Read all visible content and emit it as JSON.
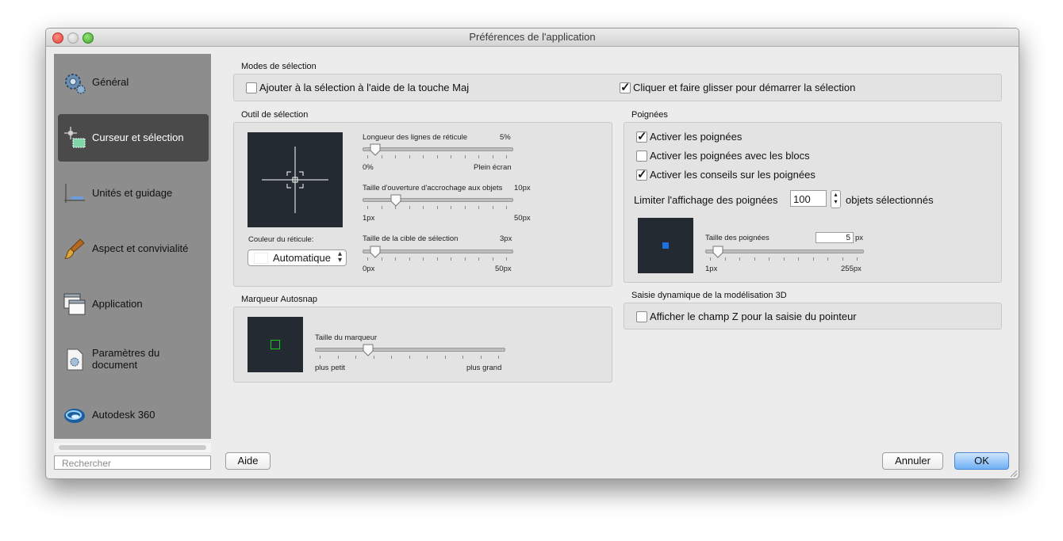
{
  "window": {
    "title": "Préférences de l'application"
  },
  "sidebar": {
    "items": [
      {
        "label": "Général",
        "icon": "gear-icon",
        "active": false
      },
      {
        "label": "Curseur et sélection",
        "icon": "crosshair-selection-icon",
        "active": true
      },
      {
        "label": "Unités et guidage",
        "icon": "ruler-icon",
        "active": false
      },
      {
        "label": "Aspect et convivialité",
        "icon": "paintbrush-icon",
        "active": false
      },
      {
        "label": "Application",
        "icon": "windows-icon",
        "active": false
      },
      {
        "label_line1": "Paramètres du",
        "label_line2": "document",
        "icon": "document-gear-icon",
        "active": false
      },
      {
        "label": "Autodesk 360",
        "icon": "autodesk-360-icon",
        "active": false
      }
    ],
    "search_placeholder": "Rechercher"
  },
  "selection_modes": {
    "title": "Modes de sélection",
    "shift_add": {
      "label": "Ajouter à la sélection à l'aide de la touche Maj",
      "checked": false
    },
    "click_drag": {
      "label": "Cliquer et faire glisser pour démarrer la sélection",
      "checked": true
    }
  },
  "selection_tool": {
    "title": "Outil de sélection",
    "crosshair_length": {
      "label": "Longueur des lignes de réticule",
      "value": "5%",
      "min": "0%",
      "max": "Plein écran",
      "fraction": 0.05
    },
    "aperture_size": {
      "label": "Taille d'ouverture d'accrochage aux objets",
      "value": "10px",
      "min": "1px",
      "max": "50px",
      "fraction": 0.2
    },
    "pickbox_size": {
      "label": "Taille de la cible de sélection",
      "value": "3px",
      "min": "0px",
      "max": "50px",
      "fraction": 0.05
    },
    "crosshair_color": {
      "label": "Couleur du réticule:",
      "value": "Automatique"
    }
  },
  "grips": {
    "title": "Poignées",
    "enable": {
      "label": "Activer les poignées",
      "checked": true
    },
    "in_blocks": {
      "label": "Activer les poignées avec les blocs",
      "checked": false
    },
    "tips": {
      "label": "Activer les conseils sur les poignées",
      "checked": true
    },
    "limit_before": "Limiter l'affichage des poignées",
    "limit_value": "100",
    "limit_after": "objets sélectionnés",
    "size": {
      "label": "Taille des poignées",
      "value": "5",
      "unit": "px",
      "min": "1px",
      "max": "255px",
      "fraction": 0.05
    },
    "grip_color": "#1e6fe0"
  },
  "autosnap": {
    "title": "Marqueur Autosnap",
    "size": {
      "label": "Taille du marqueur",
      "min": "plus petit",
      "max": "plus grand",
      "fraction": 0.27
    },
    "marker_color": "#19c619"
  },
  "dynamic_input": {
    "title": "Saisie dynamique de la modélisation 3D",
    "z_field": {
      "label": "Afficher le champ Z pour la saisie du pointeur",
      "checked": false
    }
  },
  "buttons": {
    "help": "Aide",
    "cancel": "Annuler",
    "ok": "OK"
  }
}
